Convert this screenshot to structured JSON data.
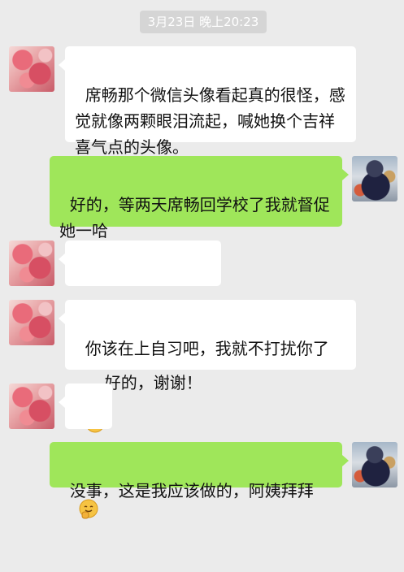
{
  "timestamp": "3月23日 晚上20:23",
  "messages": [
    {
      "side": "left",
      "text": "席畅那个微信头像看起真的很怪，感觉就像两颗眼泪流起，喊她换个吉祥喜气点的头像。"
    },
    {
      "side": "right",
      "text": "好的，等两天席畅回学校了我就督促她一哈"
    },
    {
      "side": "left",
      "text": "好的，谢谢！",
      "leading_emoji": "smile-emoji-icon"
    },
    {
      "side": "left",
      "text": "你该在上自习吧，我就不打扰你了",
      "trailing_emoji": "smile-emoji-icon"
    },
    {
      "side": "left",
      "text": "",
      "emoji_only": "grin-hand-emoji-icon"
    },
    {
      "side": "right",
      "text": "没事，这是我应该做的，阿姨拜拜"
    }
  ],
  "colors": {
    "background": "#ebebeb",
    "incoming_bubble": "#ffffff",
    "outgoing_bubble": "#9fe65a",
    "timestamp_bg": "#d5d5d5"
  }
}
